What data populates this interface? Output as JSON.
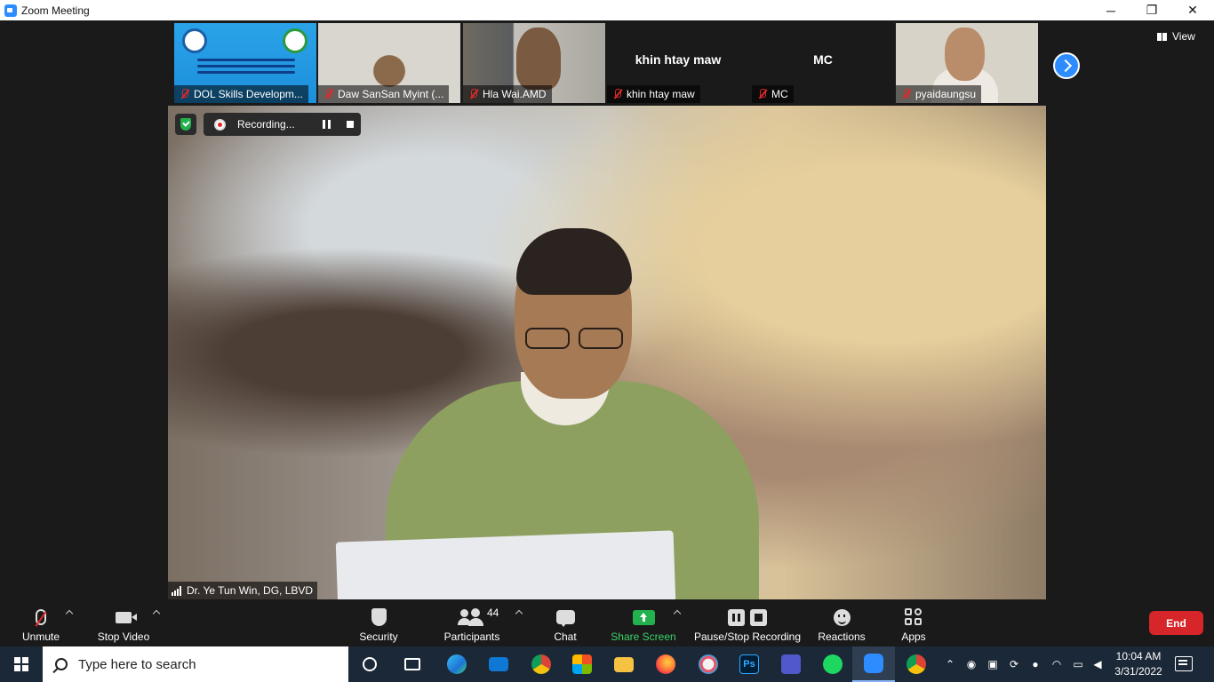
{
  "window": {
    "title": "Zoom Meeting",
    "controls": {
      "minimize": "─",
      "maximize": "❐",
      "close": "✕"
    }
  },
  "gallery": {
    "tiles": [
      {
        "name": "DOL Skills Developm...",
        "muted": true,
        "video": true
      },
      {
        "name": "Daw SanSan Myint  (...",
        "muted": true,
        "video": true
      },
      {
        "name": "Hla Wai.AMD",
        "muted": true,
        "video": true
      },
      {
        "name": "khin htay maw",
        "display_name": "khin htay maw",
        "muted": true,
        "video": false
      },
      {
        "name": "MC",
        "display_name": "MC",
        "muted": true,
        "video": false
      },
      {
        "name": "pyaidaungsu",
        "muted": true,
        "video": true
      }
    ],
    "view_label": "View"
  },
  "main_video": {
    "speaker_name": "Dr. Ye Tun Win, DG, LBVD",
    "recording_label": "Recording..."
  },
  "toolbar": {
    "unmute": "Unmute",
    "stop_video": "Stop Video",
    "security": "Security",
    "participants": "Participants",
    "participant_count": "44",
    "chat": "Chat",
    "share_screen": "Share Screen",
    "pause_stop_recording": "Pause/Stop Recording",
    "reactions": "Reactions",
    "apps": "Apps",
    "end": "End"
  },
  "taskbar": {
    "search_placeholder": "Type here to search",
    "time": "10:04 AM",
    "date": "3/31/2022",
    "apps": [
      "task-view",
      "edge",
      "mail",
      "chrome",
      "store",
      "file-explorer",
      "firefox",
      "paint",
      "photoshop",
      "teams",
      "spotify",
      "zoom",
      "chrome-profile"
    ]
  },
  "colors": {
    "zoom_blue": "#2d8cff",
    "end_red": "#d7262a",
    "share_green": "#23b14d",
    "muted_red": "#e02828",
    "taskbar": "#1b2837"
  }
}
